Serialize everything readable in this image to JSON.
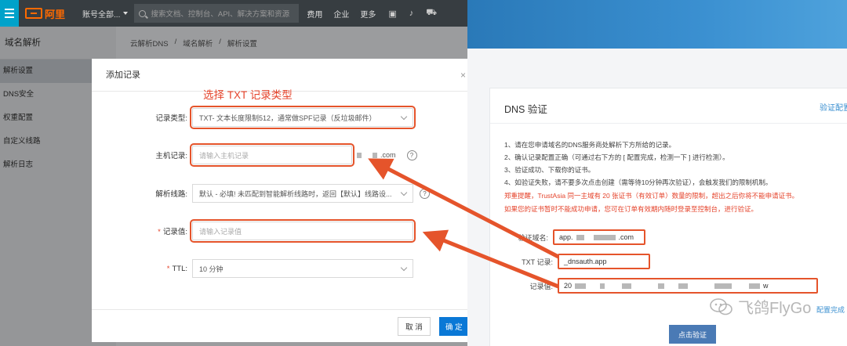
{
  "console": {
    "logo_text": "阿里",
    "account": "账号全部...",
    "search_placeholder": "搜索文档、控制台、API、解决方案和资源",
    "nav": [
      "费用",
      "企业",
      "更多"
    ],
    "breadcrumb": [
      "云解析DNS",
      "域名解析",
      "解析设置"
    ],
    "sidebar_title": "域名解析",
    "sidebar_items": [
      "解析设置",
      "DNS安全",
      "权重配置",
      "自定义线路",
      "解析日志"
    ]
  },
  "modal": {
    "title": "添加记录",
    "annotation": "选择 TXT 记录类型",
    "record_type": {
      "label": "记录类型:",
      "value": "TXT- 文本长度限制512，通常做SPF记录（反垃圾邮件）"
    },
    "host": {
      "label": "主机记录:",
      "placeholder": "请输入主机记录",
      "suffix": ".com"
    },
    "line": {
      "label": "解析线路:",
      "value": "默认 - 必填! 未匹配到智能解析线路时，返回【默认】线路设..."
    },
    "value": {
      "label": "记录值:",
      "placeholder": "请输入记录值"
    },
    "ttl": {
      "label": "TTL:",
      "value": "10 分钟"
    },
    "cancel": "取 消",
    "ok": "确 定"
  },
  "dns_panel": {
    "title": "DNS 验证",
    "config_link": "验证配置",
    "instructions": [
      "1、请在您申请域名的DNS服务商处解析下方所给的记录。",
      "2、确认记录配置正确（可通过右下方的 [ 配置完成，检测一下 ] 进行检测）。",
      "3、验证成功、下载你的证书。",
      "4、如验证失败，请不要多次点击创建（需等待10分钟再次验证），会触发我们的限制机制。"
    ],
    "warnings": [
      "郑重提醒，TrustAsia 同一主域有 20 张证书（有效订单）数量的限制，超出之后你将不能申请证书。",
      "如果您的证书暂时不能成功申请，您可在订单有效期内随时登录至控制台，进行验证。"
    ],
    "domain": {
      "label": "验证域名:",
      "prefix": "app.",
      "suffix": ".com"
    },
    "txt": {
      "label": "TXT 记录:",
      "value": "_dnsauth.app"
    },
    "record_value": {
      "label": "记录值:",
      "prefix": "20",
      "suffix": "w"
    },
    "complete_link": "配置完成",
    "verify_button": "点击验证",
    "watermark": "飞鸽FlyGo"
  },
  "colors": {
    "accent_red": "#e5542b",
    "aliyun_orange": "#ff6a00",
    "primary_blue": "#0a78d6",
    "topbar": "#373d41"
  }
}
